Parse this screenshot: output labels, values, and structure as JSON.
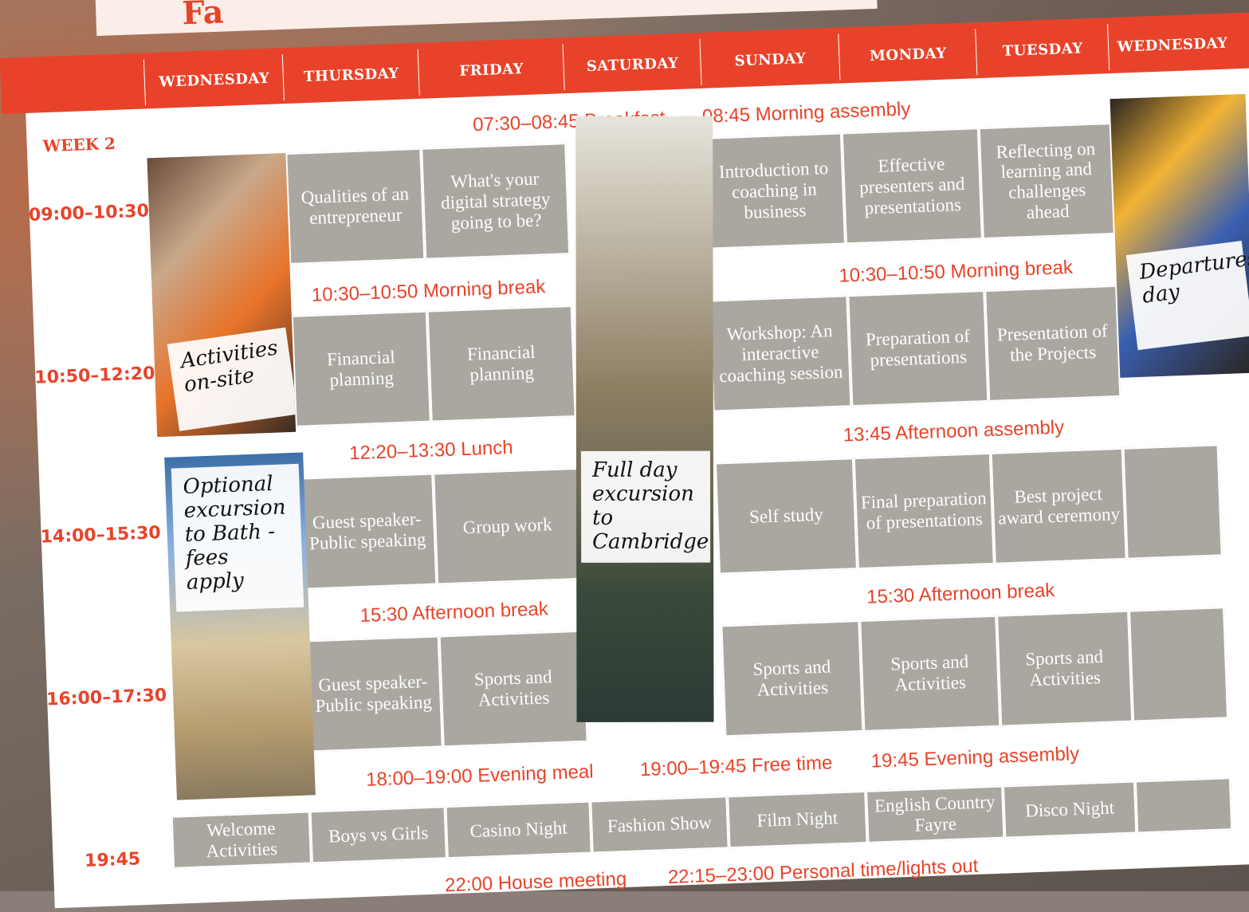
{
  "header": {
    "title_fragment": "Fa"
  },
  "week_label": "WEEK 2",
  "days": [
    "WEDNESDAY",
    "THURSDAY",
    "FRIDAY",
    "SATURDAY",
    "SUNDAY",
    "MONDAY",
    "TUESDAY",
    "WEDNESDAY"
  ],
  "times": [
    "09:00–10:30",
    "10:50–12:20",
    "14:00–15:30",
    "16:00–17:30",
    "19:45"
  ],
  "bands": {
    "breakfast": "07:30–08:45 Breakfast",
    "assembly": "08:45 Morning assembly",
    "morning_break": "10:30–10:50 Morning break",
    "lunch": "12:20–13:30 Lunch",
    "afternoon_assembly": "13:45 Afternoon assembly",
    "afternoon_break": "15:30 Afternoon break",
    "evening_meal": "18:00–19:00  Evening meal",
    "free_time": "19:00–19:45 Free time",
    "evening_assembly": "19:45 Evening assembly",
    "house_meeting": "22:00 House meeting",
    "lights_out": "22:15–23:00 Personal time/lights out"
  },
  "sessions": {
    "thu_s1": "Qualities of an entrepreneur",
    "fri_s1": "What's your digital strategy going to be?",
    "sun_s1": "Introduction to coaching in business",
    "mon_s1": "Effective presenters and presentations",
    "tue_s1": "Reflecting on learning and challenges ahead",
    "thu_s2": "Financial planning",
    "fri_s2": "Financial planning",
    "sun_s2": "Workshop: An interactive coaching session",
    "mon_s2": "Preparation of presentations",
    "tue_s2": "Presentation of the Projects",
    "thu_s3": "Guest speaker-Public speaking",
    "fri_s3": "Group work",
    "sun_s3": "Self study",
    "mon_s3": "Final preparation of presentations",
    "tue_s3": "Best project award ceremony",
    "thu_s4": "Guest speaker-Public speaking",
    "fri_s4": "Sports and Activities",
    "sun_s4": "Sports and Activities",
    "mon_s4": "Sports and Activities",
    "tue_s4": "Sports and Activities"
  },
  "evening": [
    "Welcome Activities",
    "Boys vs Girls",
    "Casino Night",
    "Fashion Show",
    "Film Night",
    "English Country Fayre",
    "Disco Night"
  ],
  "notes": {
    "activities": "Activities on-site",
    "bath": "Optional excursion to Bath - fees apply",
    "cambridge": "Full day excursion to Cambridge",
    "departures": "Departures day"
  },
  "colors": {
    "accent": "#e8432a",
    "cell": "#aaa7a1"
  }
}
